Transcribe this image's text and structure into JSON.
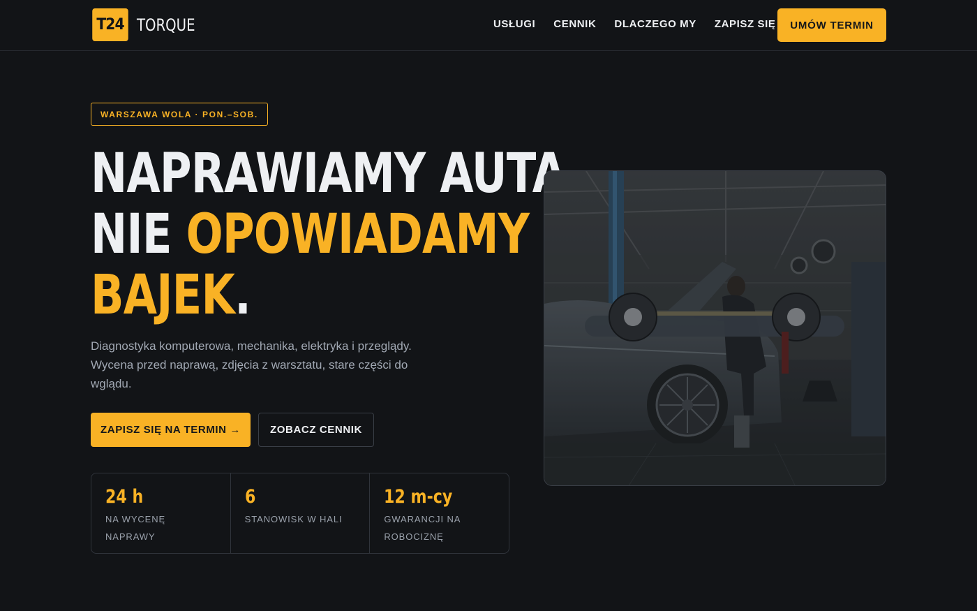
{
  "brand": {
    "badge": "T24",
    "name": "TORQUE"
  },
  "nav": {
    "items": [
      "USŁUGI",
      "CENNIK",
      "DLACZEGO MY",
      "ZAPISZ SIĘ"
    ],
    "cta": "UMÓW TERMIN"
  },
  "hero": {
    "tag": "WARSZAWA WOLA · PON.–SOB.",
    "headline": {
      "line1": "NAPRAWIAMY AUTA,",
      "line2_plain": "NIE ",
      "line2_accent": "OPOWIADAMY",
      "line3_accent": "BAJEK",
      "line3_plain": "."
    },
    "lead": "Diagnostyka komputerowa, mechanika, elektryka i przeglądy. Wycena przed naprawą, zdjęcia z warsztatu, stare części do wglądu.",
    "primary_button": "ZAPISZ SIĘ NA TERMIN →",
    "secondary_button": "ZOBACZ CENNIK"
  },
  "stats": [
    {
      "value": "24 h",
      "label": "NA WYCENĘ NAPRAWY"
    },
    {
      "value": "6",
      "label": "STANOWISK W HALI"
    },
    {
      "value": "12 m-cy",
      "label": "GWARANCJI NA ROBOCIZNĘ"
    }
  ],
  "colors": {
    "background": "#121417",
    "accent": "#f9b225",
    "text": "#eef0f3",
    "muted": "#a1a8b3"
  }
}
